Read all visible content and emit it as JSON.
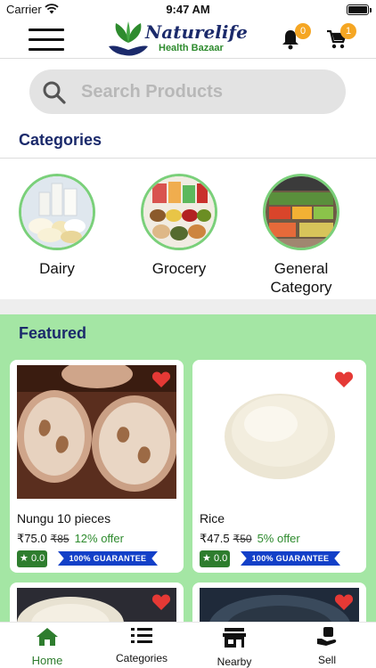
{
  "status_bar": {
    "carrier": "Carrier",
    "time": "9:47 AM"
  },
  "header": {
    "logo_title": "Naturelife",
    "logo_subtitle": "Health Bazaar",
    "notifications_count": "0",
    "cart_count": "1"
  },
  "search": {
    "placeholder": "Search Products"
  },
  "categories": {
    "title": "Categories",
    "items": [
      {
        "label": "Dairy"
      },
      {
        "label": "Grocery"
      },
      {
        "label": "General Category"
      }
    ]
  },
  "featured": {
    "title": "Featured",
    "products": [
      {
        "name": "Nungu 10 pieces",
        "price": "₹75.0",
        "mrp": "₹85",
        "offer": "12% offer",
        "rating": "0.0",
        "guarantee": "100% GUARANTEE"
      },
      {
        "name": "Rice",
        "price": "₹47.5",
        "mrp": "₹50",
        "offer": "5% offer",
        "rating": "0.0",
        "guarantee": "100% GUARANTEE"
      }
    ]
  },
  "tabbar": {
    "items": [
      {
        "label": "Home"
      },
      {
        "label": "Categories"
      },
      {
        "label": "Nearby"
      },
      {
        "label": "Sell"
      }
    ]
  },
  "colors": {
    "accent": "#1b2a6b",
    "green": "#2e7d2e",
    "featured_bg": "#a4e6a4",
    "badge": "#f5a623",
    "heart": "#e53935"
  }
}
